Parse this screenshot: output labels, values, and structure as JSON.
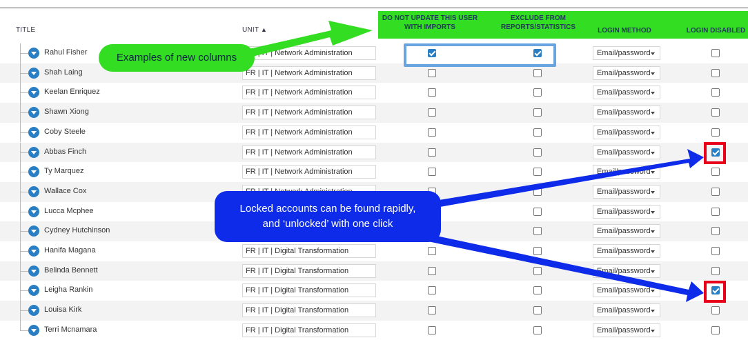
{
  "columns": {
    "title": "TITLE",
    "unit": "UNIT",
    "do_not_update": "DO NOT UPDATE THIS USER WITH IMPORTS",
    "exclude": "EXCLUDE FROM REPORTS/STATISTICS",
    "login_method": "LOGIN METHOD",
    "login_disabled": "LOGIN DISABLED"
  },
  "rows": [
    {
      "name": "Rahul Fisher",
      "unit": "FR | IT | Network Administration",
      "do_not_update": true,
      "exclude": true,
      "login_method": "Email/password",
      "login_disabled": false
    },
    {
      "name": "Shah Laing",
      "unit": "FR | IT | Network Administration",
      "do_not_update": false,
      "exclude": false,
      "login_method": "Email/password",
      "login_disabled": false
    },
    {
      "name": "Keelan Enriquez",
      "unit": "FR | IT | Network Administration",
      "do_not_update": false,
      "exclude": false,
      "login_method": "Email/password",
      "login_disabled": false
    },
    {
      "name": "Shawn Xiong",
      "unit": "FR | IT | Network Administration",
      "do_not_update": false,
      "exclude": false,
      "login_method": "Email/password",
      "login_disabled": false
    },
    {
      "name": "Coby Steele",
      "unit": "FR | IT | Network Administration",
      "do_not_update": false,
      "exclude": false,
      "login_method": "Email/password",
      "login_disabled": false
    },
    {
      "name": "Abbas Finch",
      "unit": "FR | IT | Network Administration",
      "do_not_update": false,
      "exclude": false,
      "login_method": "Email/password",
      "login_disabled": true
    },
    {
      "name": "Ty Marquez",
      "unit": "FR | IT | Network Administration",
      "do_not_update": false,
      "exclude": false,
      "login_method": "Email/password",
      "login_disabled": false
    },
    {
      "name": "Wallace Cox",
      "unit": "FR | IT | Network Administration",
      "do_not_update": false,
      "exclude": false,
      "login_method": "Email/password",
      "login_disabled": false
    },
    {
      "name": "Lucca Mcphee",
      "unit": "FR | IT | Network Administration",
      "do_not_update": false,
      "exclude": false,
      "login_method": "Email/password",
      "login_disabled": false
    },
    {
      "name": "Cydney Hutchinson",
      "unit": "FR | IT | Network Administration",
      "do_not_update": false,
      "exclude": false,
      "login_method": "Email/password",
      "login_disabled": false
    },
    {
      "name": "Hanifa Magana",
      "unit": "FR | IT | Digital Transformation",
      "do_not_update": false,
      "exclude": false,
      "login_method": "Email/password",
      "login_disabled": false
    },
    {
      "name": "Belinda Bennett",
      "unit": "FR | IT | Digital Transformation",
      "do_not_update": false,
      "exclude": false,
      "login_method": "Email/password",
      "login_disabled": false
    },
    {
      "name": "Leigha Rankin",
      "unit": "FR | IT | Digital Transformation",
      "do_not_update": false,
      "exclude": false,
      "login_method": "Email/password",
      "login_disabled": true
    },
    {
      "name": "Louisa Kirk",
      "unit": "FR | IT | Digital Transformation",
      "do_not_update": false,
      "exclude": false,
      "login_method": "Email/password",
      "login_disabled": false
    },
    {
      "name": "Terri Mcnamara",
      "unit": "FR | IT | Digital Transformation",
      "do_not_update": false,
      "exclude": false,
      "login_method": "Email/password",
      "login_disabled": false
    }
  ],
  "annotations": {
    "new_columns": "Examples  of new columns",
    "locked_line1": "Locked accounts can be found rapidly,",
    "locked_line2": "and ‘unlocked’ with one click"
  },
  "colors": {
    "highlight_green": "#33dd22",
    "callout_blue": "#0d2be8",
    "highlight_red": "#e8001a",
    "accent_blue": "#2a7fc4"
  }
}
